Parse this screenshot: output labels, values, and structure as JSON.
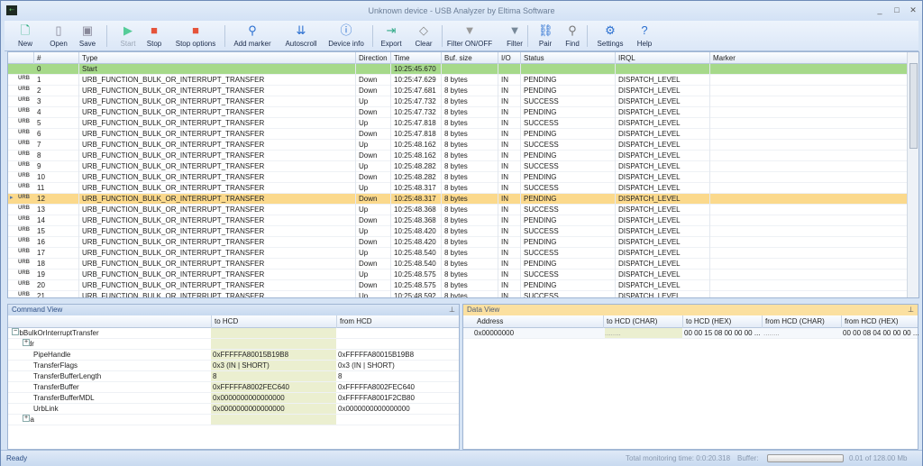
{
  "window": {
    "title": "Unknown device - USB Analyzer by Eltima Software",
    "minimize": "_",
    "maximize": "□",
    "close": "✕"
  },
  "toolbar": [
    {
      "label": "New",
      "icon": "new-file-icon"
    },
    {
      "label": "Open",
      "icon": "open-icon"
    },
    {
      "label": "Save",
      "icon": "save-icon"
    },
    {
      "label": "Start",
      "icon": "play-icon"
    },
    {
      "label": "Stop",
      "icon": "stop-icon"
    },
    {
      "label": "Stop options",
      "icon": "stop-options-icon"
    },
    {
      "label": "Add marker",
      "icon": "marker-icon"
    },
    {
      "label": "Autoscroll",
      "icon": "autoscroll-icon"
    },
    {
      "label": "Device info",
      "icon": "info-icon"
    },
    {
      "label": "Export",
      "icon": "export-icon"
    },
    {
      "label": "Clear",
      "icon": "eraser-icon"
    },
    {
      "label": "Filter ON/OFF",
      "icon": "filter-icon"
    },
    {
      "label": "Filter",
      "icon": "filter-settings-icon"
    },
    {
      "label": "Pair",
      "icon": "pair-icon"
    },
    {
      "label": "Find",
      "icon": "search-icon"
    },
    {
      "label": "Settings",
      "icon": "gear-icon"
    },
    {
      "label": "Help",
      "icon": "help-icon"
    }
  ],
  "grid": {
    "columns": [
      "#",
      "Type",
      "Direction",
      "Time",
      "Buf. size",
      "I/O",
      "Status",
      "IRQL",
      "Marker"
    ],
    "rows": [
      [
        "0",
        "Start",
        "",
        "10:25:45.670",
        "",
        "",
        "",
        "",
        ""
      ],
      [
        "1",
        "URB_FUNCTION_BULK_OR_INTERRUPT_TRANSFER",
        "Down",
        "10:25:47.629",
        "8 bytes",
        "IN",
        "PENDING",
        "DISPATCH_LEVEL",
        ""
      ],
      [
        "2",
        "URB_FUNCTION_BULK_OR_INTERRUPT_TRANSFER",
        "Down",
        "10:25:47.681",
        "8 bytes",
        "IN",
        "PENDING",
        "DISPATCH_LEVEL",
        ""
      ],
      [
        "3",
        "URB_FUNCTION_BULK_OR_INTERRUPT_TRANSFER",
        "Up",
        "10:25:47.732",
        "8 bytes",
        "IN",
        "SUCCESS",
        "DISPATCH_LEVEL",
        ""
      ],
      [
        "4",
        "URB_FUNCTION_BULK_OR_INTERRUPT_TRANSFER",
        "Down",
        "10:25:47.732",
        "8 bytes",
        "IN",
        "PENDING",
        "DISPATCH_LEVEL",
        ""
      ],
      [
        "5",
        "URB_FUNCTION_BULK_OR_INTERRUPT_TRANSFER",
        "Up",
        "10:25:47.818",
        "8 bytes",
        "IN",
        "SUCCESS",
        "DISPATCH_LEVEL",
        ""
      ],
      [
        "6",
        "URB_FUNCTION_BULK_OR_INTERRUPT_TRANSFER",
        "Down",
        "10:25:47.818",
        "8 bytes",
        "IN",
        "PENDING",
        "DISPATCH_LEVEL",
        ""
      ],
      [
        "7",
        "URB_FUNCTION_BULK_OR_INTERRUPT_TRANSFER",
        "Up",
        "10:25:48.162",
        "8 bytes",
        "IN",
        "SUCCESS",
        "DISPATCH_LEVEL",
        ""
      ],
      [
        "8",
        "URB_FUNCTION_BULK_OR_INTERRUPT_TRANSFER",
        "Down",
        "10:25:48.162",
        "8 bytes",
        "IN",
        "PENDING",
        "DISPATCH_LEVEL",
        ""
      ],
      [
        "9",
        "URB_FUNCTION_BULK_OR_INTERRUPT_TRANSFER",
        "Up",
        "10:25:48.282",
        "8 bytes",
        "IN",
        "SUCCESS",
        "DISPATCH_LEVEL",
        ""
      ],
      [
        "10",
        "URB_FUNCTION_BULK_OR_INTERRUPT_TRANSFER",
        "Down",
        "10:25:48.282",
        "8 bytes",
        "IN",
        "PENDING",
        "DISPATCH_LEVEL",
        ""
      ],
      [
        "11",
        "URB_FUNCTION_BULK_OR_INTERRUPT_TRANSFER",
        "Up",
        "10:25:48.317",
        "8 bytes",
        "IN",
        "SUCCESS",
        "DISPATCH_LEVEL",
        ""
      ],
      [
        "12",
        "URB_FUNCTION_BULK_OR_INTERRUPT_TRANSFER",
        "Down",
        "10:25:48.317",
        "8 bytes",
        "IN",
        "PENDING",
        "DISPATCH_LEVEL",
        ""
      ],
      [
        "13",
        "URB_FUNCTION_BULK_OR_INTERRUPT_TRANSFER",
        "Up",
        "10:25:48.368",
        "8 bytes",
        "IN",
        "SUCCESS",
        "DISPATCH_LEVEL",
        ""
      ],
      [
        "14",
        "URB_FUNCTION_BULK_OR_INTERRUPT_TRANSFER",
        "Down",
        "10:25:48.368",
        "8 bytes",
        "IN",
        "PENDING",
        "DISPATCH_LEVEL",
        ""
      ],
      [
        "15",
        "URB_FUNCTION_BULK_OR_INTERRUPT_TRANSFER",
        "Up",
        "10:25:48.420",
        "8 bytes",
        "IN",
        "SUCCESS",
        "DISPATCH_LEVEL",
        ""
      ],
      [
        "16",
        "URB_FUNCTION_BULK_OR_INTERRUPT_TRANSFER",
        "Down",
        "10:25:48.420",
        "8 bytes",
        "IN",
        "PENDING",
        "DISPATCH_LEVEL",
        ""
      ],
      [
        "17",
        "URB_FUNCTION_BULK_OR_INTERRUPT_TRANSFER",
        "Up",
        "10:25:48.540",
        "8 bytes",
        "IN",
        "SUCCESS",
        "DISPATCH_LEVEL",
        ""
      ],
      [
        "18",
        "URB_FUNCTION_BULK_OR_INTERRUPT_TRANSFER",
        "Down",
        "10:25:48.540",
        "8 bytes",
        "IN",
        "PENDING",
        "DISPATCH_LEVEL",
        ""
      ],
      [
        "19",
        "URB_FUNCTION_BULK_OR_INTERRUPT_TRANSFER",
        "Up",
        "10:25:48.575",
        "8 bytes",
        "IN",
        "SUCCESS",
        "DISPATCH_LEVEL",
        ""
      ],
      [
        "20",
        "URB_FUNCTION_BULK_OR_INTERRUPT_TRANSFER",
        "Down",
        "10:25:48.575",
        "8 bytes",
        "IN",
        "PENDING",
        "DISPATCH_LEVEL",
        ""
      ],
      [
        "21",
        "URB_FUNCTION_BULK_OR_INTERRUPT_TRANSFER",
        "Up",
        "10:25:48.592",
        "8 bytes",
        "IN",
        "SUCCESS",
        "DISPATCH_LEVEL",
        ""
      ]
    ],
    "selected_row": "12",
    "row_icon_label": "URB"
  },
  "command_view": {
    "title": "Command View",
    "col_to": "to HCD",
    "col_from": "from HCD",
    "rows": [
      {
        "name": "UrbBulkOrInterruptTransfer",
        "to": "",
        "from": "",
        "level": 0,
        "expander": "−"
      },
      {
        "name": "Hdr",
        "to": "",
        "from": "",
        "level": 1,
        "expander": "+"
      },
      {
        "name": "PipeHandle",
        "to": "0xFFFFFA80015B19B8",
        "from": "0xFFFFFA80015B19B8",
        "level": 2,
        "expander": ""
      },
      {
        "name": "TransferFlags",
        "to": "0x3 (IN | SHORT)",
        "from": "0x3 (IN | SHORT)",
        "level": 2,
        "expander": ""
      },
      {
        "name": "TransferBufferLength",
        "to": "8",
        "from": "8",
        "level": 2,
        "expander": ""
      },
      {
        "name": "TransferBuffer",
        "to": "0xFFFFFA8002FEC640",
        "from": "0xFFFFFA8002FEC640",
        "level": 2,
        "expander": ""
      },
      {
        "name": "TransferBufferMDL",
        "to": "0x0000000000000000",
        "from": "0xFFFFFA8001F2CB80",
        "level": 2,
        "expander": ""
      },
      {
        "name": "UrbLink",
        "to": "0x0000000000000000",
        "from": "0x0000000000000000",
        "level": 2,
        "expander": ""
      },
      {
        "name": "hca",
        "to": "",
        "from": "",
        "level": 1,
        "expander": "+"
      }
    ]
  },
  "data_view": {
    "title": "Data View",
    "columns": [
      "Address",
      "to HCD (CHAR)",
      "to HCD (HEX)",
      "from HCD (CHAR)",
      "from HCD (HEX)"
    ],
    "rows": [
      [
        "0x00000000",
        "........",
        "00 00 15 08 00 00 00 ...",
        "........",
        "00 00 08 04 00 00 00 ..."
      ]
    ]
  },
  "statusbar": {
    "ready": "Ready",
    "monitoring": "Total monitoring time: 0:0:20.318",
    "buffer_label": "Buffer:",
    "buffer_value": "0.01 of 128.00 Mb",
    "buffer_fraction": 0.0001
  }
}
